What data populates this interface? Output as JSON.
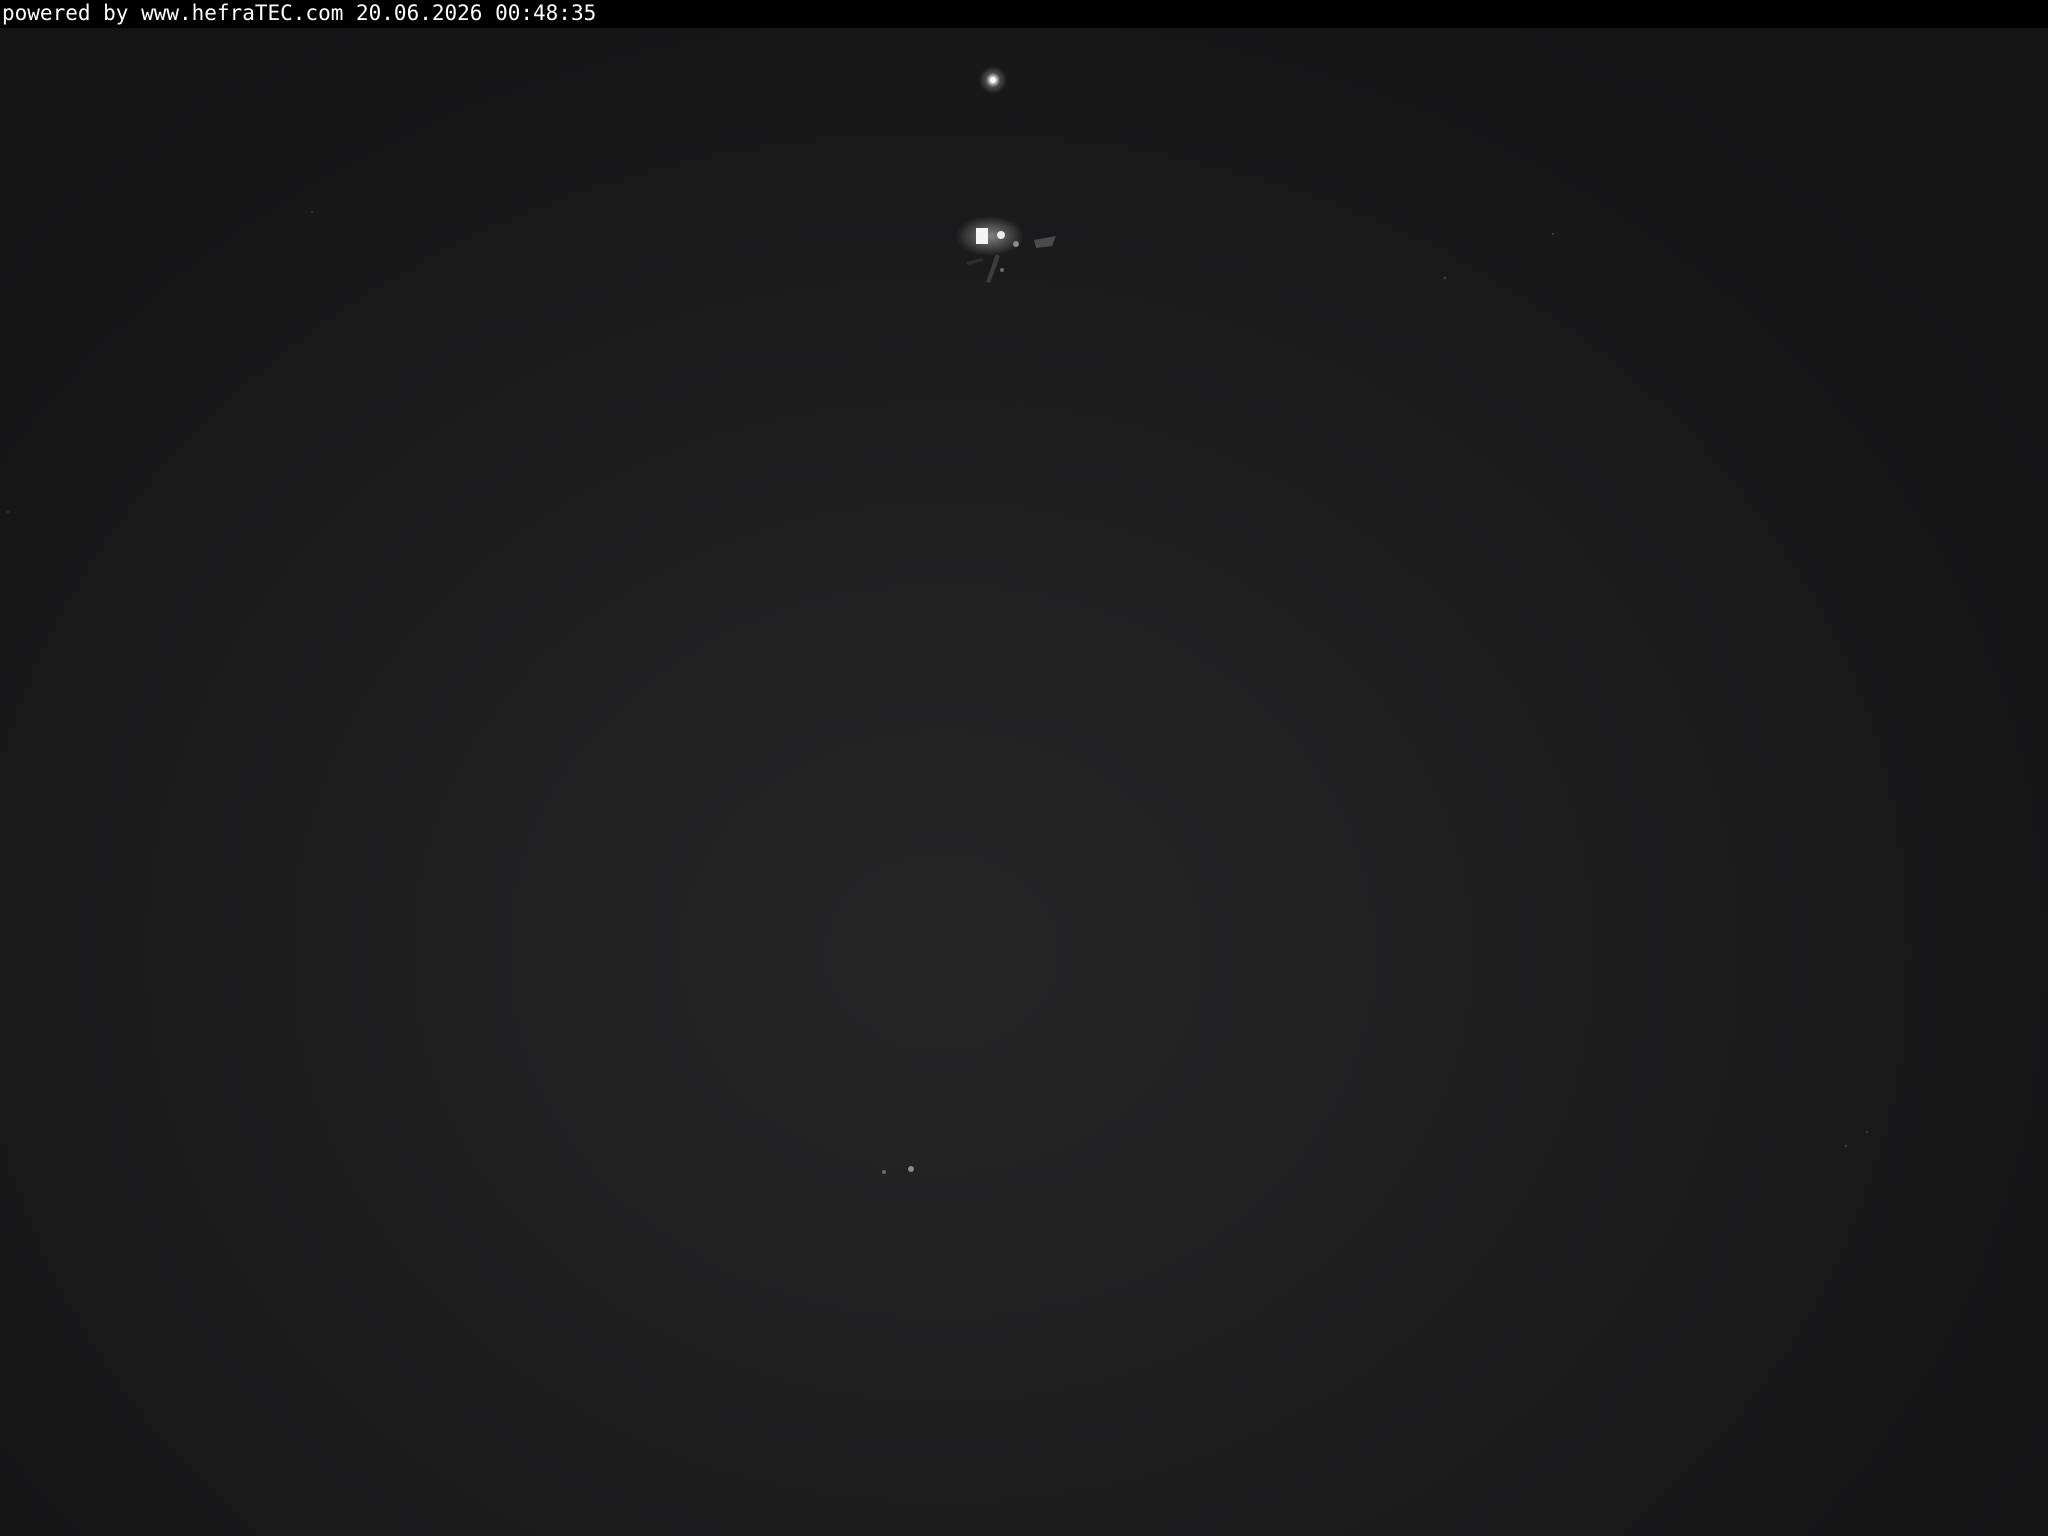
{
  "overlay": {
    "text": "powered by www.hefraTEC.com 20.06.2026 00:48:35"
  },
  "scene": {
    "description_icon": "night-webcam-scene",
    "lights": [
      {
        "name": "top-star-light",
        "brightness": 1.0
      },
      {
        "name": "building-light-cluster",
        "brightness": 1.0
      },
      {
        "name": "distant-light-pair",
        "brightness": 0.6
      }
    ]
  }
}
